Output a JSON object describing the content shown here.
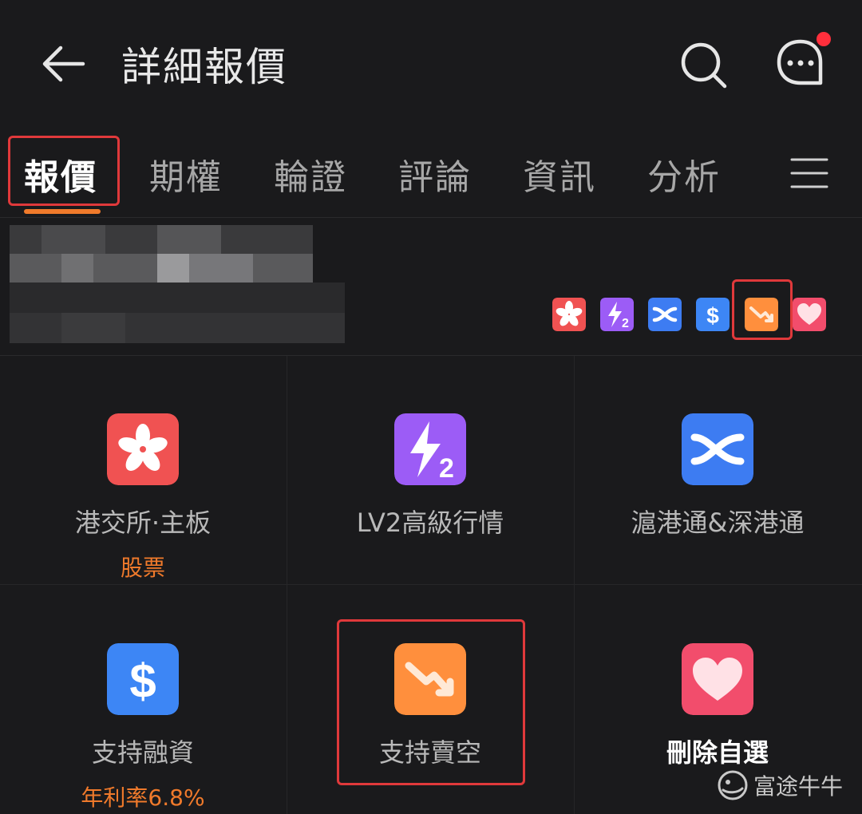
{
  "header": {
    "title": "詳細報價"
  },
  "tabs": [
    {
      "label": "報價",
      "active": true
    },
    {
      "label": "期權",
      "active": false
    },
    {
      "label": "輪證",
      "active": false
    },
    {
      "label": "評論",
      "active": false
    },
    {
      "label": "資訊",
      "active": false
    },
    {
      "label": "分析",
      "active": false
    }
  ],
  "badges": [
    {
      "name": "hkex-badge",
      "color": "#f05252"
    },
    {
      "name": "lv2-badge",
      "color": "#9c5cf6"
    },
    {
      "name": "connect-badge",
      "color": "#3d7cf2"
    },
    {
      "name": "margin-badge",
      "color": "#3d7cf2"
    },
    {
      "name": "short-sell-badge",
      "color": "#ff8f3d"
    },
    {
      "name": "favorite-badge",
      "color": "#f24d6c"
    }
  ],
  "features": [
    {
      "label": "港交所·主板",
      "sub": "股票",
      "icon": "hk-flower-icon",
      "color": "#f05252"
    },
    {
      "label": "LV2高級行情",
      "sub": "",
      "icon": "lv2-lightning-icon",
      "color": "#9c5cf6"
    },
    {
      "label": "滬港通&深港通",
      "sub": "",
      "icon": "connect-arrows-icon",
      "color": "#3d7cf2"
    },
    {
      "label": "支持融資",
      "sub": "年利率6.8%",
      "icon": "dollar-icon",
      "color": "#3d86f5"
    },
    {
      "label": "支持賣空",
      "sub": "",
      "icon": "short-sell-icon",
      "color": "#ff8f3d"
    },
    {
      "label": "刪除自選",
      "sub": "",
      "icon": "heart-icon",
      "color": "#f24d6c"
    }
  ],
  "watermark": {
    "text": "富途牛牛"
  }
}
